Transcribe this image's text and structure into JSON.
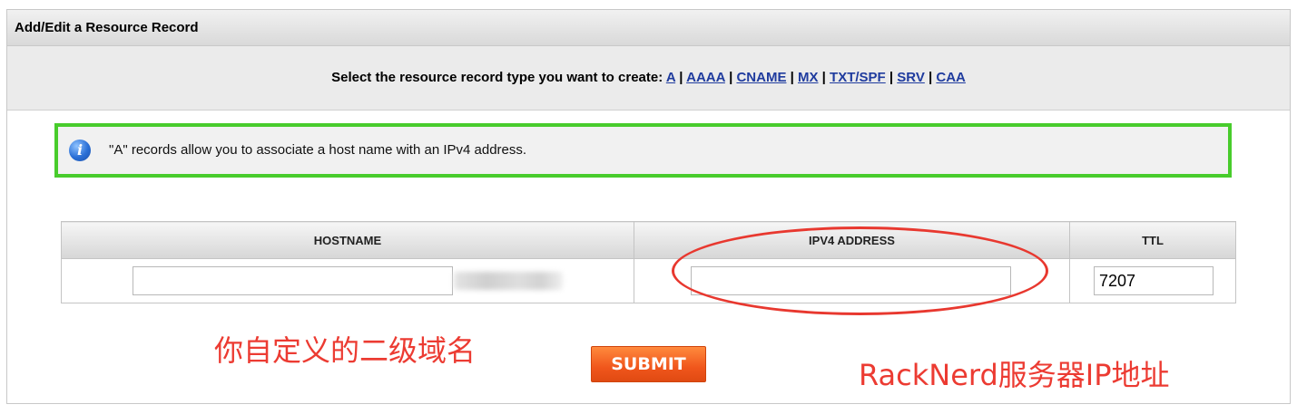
{
  "panel": {
    "title": "Add/Edit a Resource Record"
  },
  "type_selector": {
    "prompt": "Select the resource record type you want to create:",
    "types": [
      "A",
      "AAAA",
      "CNAME",
      "MX",
      "TXT/SPF",
      "SRV",
      "CAA"
    ],
    "separator": "|"
  },
  "info": {
    "icon": "info-icon",
    "text": "\"A\" records allow you to associate a host name with an IPv4 address.",
    "border_color": "#48cc2c"
  },
  "table": {
    "headers": [
      "HOSTNAME",
      "IPV4 ADDRESS",
      "TTL"
    ],
    "hostname_value": "",
    "ipv4_value": "",
    "ttl_value": "7207"
  },
  "submit_label": "SUBMIT",
  "annotations": {
    "left_note": "你自定义的二级域名",
    "right_note": "RackNerd服务器IP地址",
    "color": "#ec3b32"
  }
}
